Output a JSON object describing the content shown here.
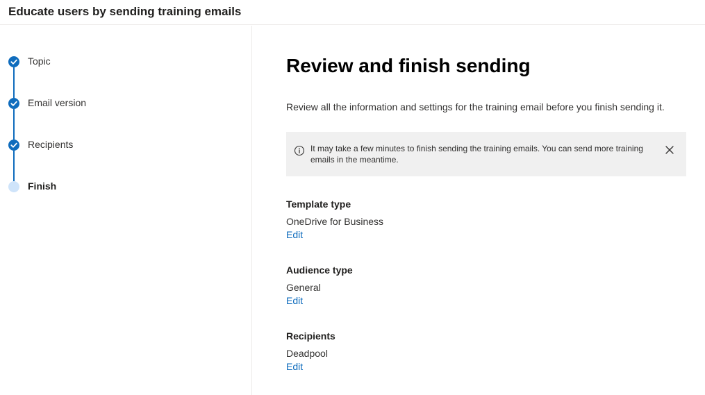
{
  "header": {
    "title": "Educate users by sending training emails"
  },
  "wizard": {
    "steps": [
      {
        "label": "Topic",
        "status": "completed"
      },
      {
        "label": "Email version",
        "status": "completed"
      },
      {
        "label": "Recipients",
        "status": "completed"
      },
      {
        "label": "Finish",
        "status": "current"
      }
    ]
  },
  "main": {
    "title": "Review and finish sending",
    "description": "Review all the information and settings for the training email before you finish sending it.",
    "info_message": "It may take a few minutes to finish sending the training emails. You can send more training emails in the meantime.",
    "sections": [
      {
        "heading": "Template type",
        "value": "OneDrive for Business",
        "edit_label": "Edit"
      },
      {
        "heading": "Audience type",
        "value": "General",
        "edit_label": "Edit"
      },
      {
        "heading": "Recipients",
        "value": "Deadpool",
        "edit_label": "Edit"
      }
    ]
  },
  "colors": {
    "accent": "#0f6cbd",
    "pending_step": "#cfe4fa",
    "info_background": "#f0f0f0",
    "divider": "#edebe9"
  },
  "icons": {
    "completed_step": "checkmark-circle-icon",
    "info": "info-icon",
    "dismiss": "close-icon"
  }
}
